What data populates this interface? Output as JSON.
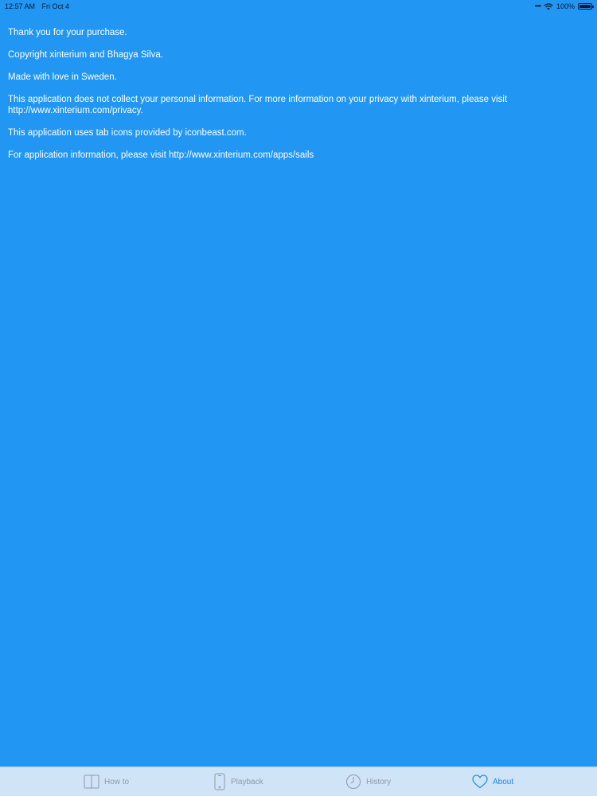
{
  "status_bar": {
    "time": "12:57 AM",
    "date": "Fri Oct 4",
    "battery": "100%",
    "battery_level": 1.0
  },
  "content": {
    "paragraphs": [
      "Thank you for your purchase.",
      "Copyright xinterium and Bhagya Silva.",
      "Made with love in Sweden.",
      "This application does not collect your personal information. For more information on your privacy with xinterium, please visit http://www.xinterium.com/privacy.",
      "This application uses tab icons provided by iconbeast.com.",
      "For application information, please visit http://www.xinterium.com/apps/sails"
    ]
  },
  "tab_bar": {
    "tabs": [
      {
        "label": "How to",
        "icon": "book-icon"
      },
      {
        "label": "Playback",
        "icon": "phone-icon"
      },
      {
        "label": "History",
        "icon": "clock-icon"
      },
      {
        "label": "About",
        "icon": "heart-icon"
      }
    ],
    "active_tab": "About"
  },
  "colors": {
    "background": "#2196f3",
    "tab_bar_background": "#cfe4f6",
    "tab_inactive": "#8e9aa6",
    "tab_active": "#1e88e5"
  }
}
